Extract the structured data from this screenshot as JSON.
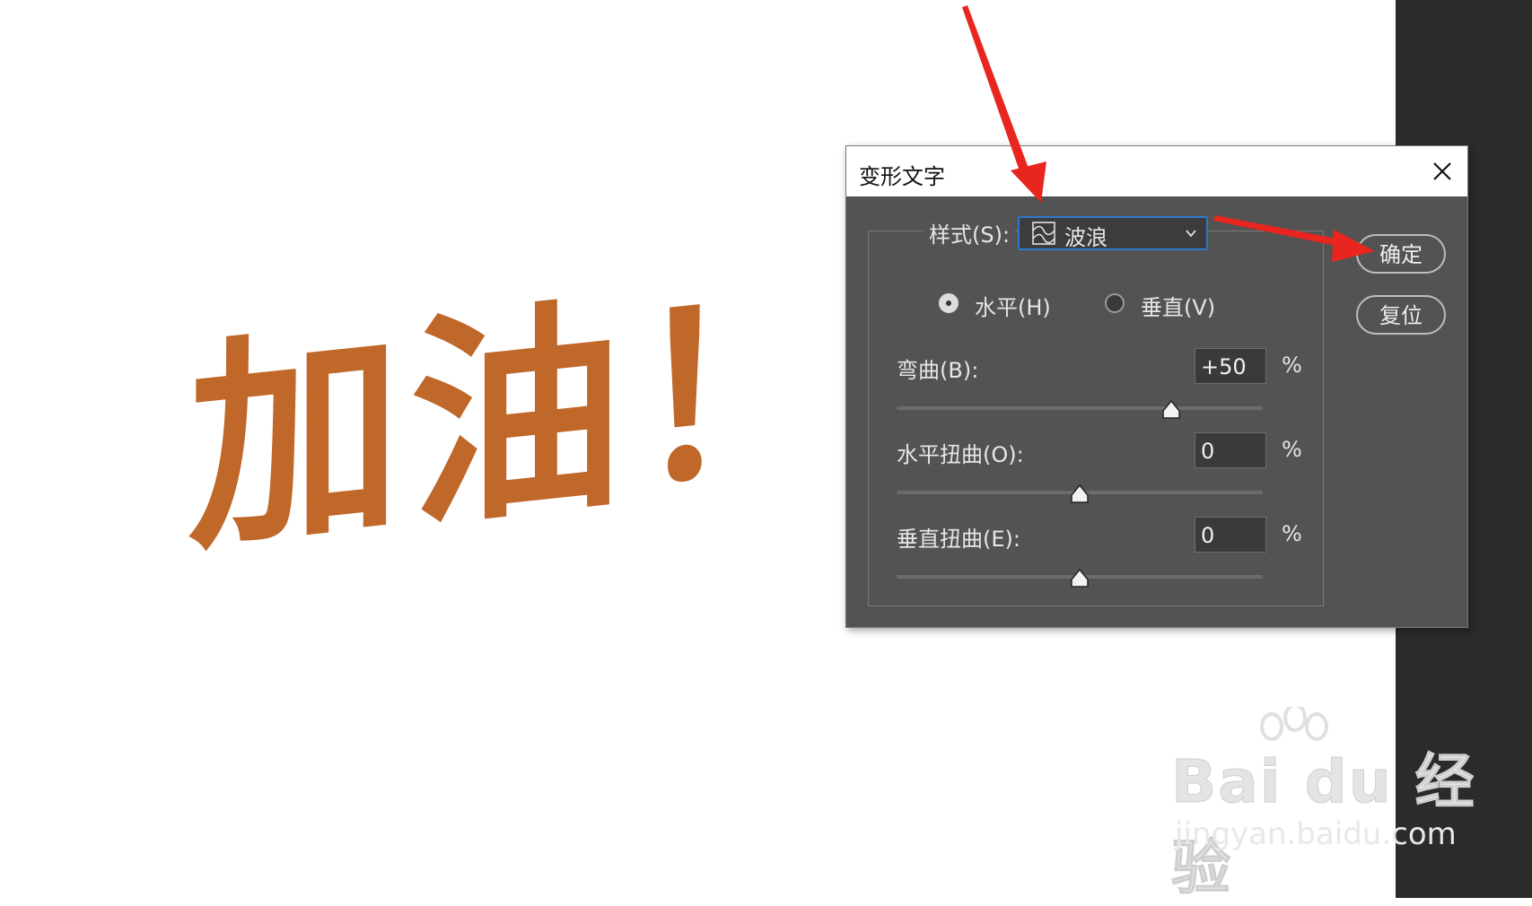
{
  "canvas": {
    "warped_text": "加油！",
    "text_color": "#c0672a"
  },
  "dialog": {
    "title": "变形文字",
    "style": {
      "label": "样式(S):",
      "selected": "波浪",
      "icon": "wave-style-icon"
    },
    "orientation": {
      "horizontal_label": "水平(H)",
      "vertical_label": "垂直(V)",
      "selected": "horizontal"
    },
    "bend": {
      "label": "弯曲(B):",
      "value": "+50",
      "unit": "%",
      "level": 0.75
    },
    "horizontal_distortion": {
      "label": "水平扭曲(O):",
      "value": "0",
      "unit": "%",
      "level": 0.5
    },
    "vertical_distortion": {
      "label": "垂直扭曲(E):",
      "value": "0",
      "unit": "%",
      "level": 0.5
    },
    "buttons": {
      "ok": "确定",
      "reset": "复位"
    },
    "close_icon": "close-icon"
  },
  "watermark": {
    "logo": "Bai du 经验",
    "url": "jingyan.baidu.com"
  },
  "colors": {
    "dialog_bg": "#535353",
    "accent": "#2e77cc",
    "annotation_arrow": "#e8261f"
  }
}
